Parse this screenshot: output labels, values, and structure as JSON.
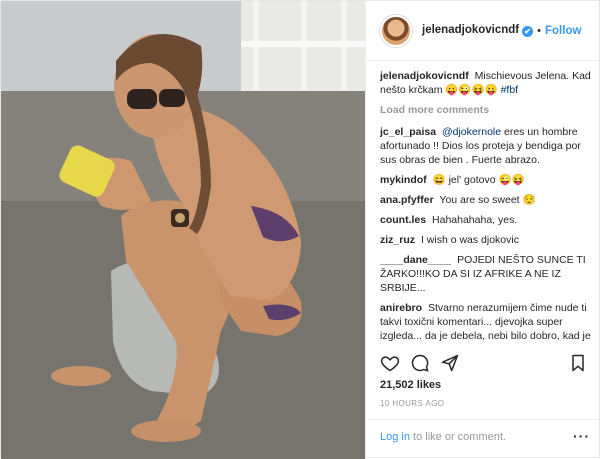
{
  "header": {
    "username": "jelenadjokovicndf",
    "dot": "•",
    "follow_label": "Follow"
  },
  "caption": {
    "username": "jelenadjokovicndf",
    "text": "Mischievous Jelena. Kad nešto krčkam 😛😜😝😛",
    "hashtag": "#fbf"
  },
  "load_more_label": "Load more comments",
  "comments": [
    {
      "username": "jc_el_paisa",
      "mention": "@djokernole",
      "text": "eres un hombre afortunado !! Dios los proteja y bendiga por sus obras de bien . Fuerte abrazo."
    },
    {
      "username": "mykindof",
      "text": "😄 jel' gotovo 😜😝"
    },
    {
      "username": "ana.pfyffer",
      "text": "You are so sweet 😌"
    },
    {
      "username": "count.les",
      "text": "Hahahahaha, yes."
    },
    {
      "username": "ziz_ruz",
      "text": "I wish o was djokovic"
    },
    {
      "username": "____dane____",
      "text": "POJEDI NEŠTO SUNCE TI ŽARKO!!!KO DA SI IZ AFRIKE A NE IZ SRBIJE..."
    },
    {
      "username": "anirebro",
      "text": "Stvarno nerazumijem čime nude ti takvi toxični komentari... djevojka super izgleda... da je debela, nebi bilo dobro, kad je mršava isto nije dobro! Svak ima različiti metabolizam i stav života... ako nemate ništa lijepo za reći, ne pišite!"
    }
  ],
  "likes": "21,502 likes",
  "timestamp": "10 HOURS AGO",
  "footer": {
    "login_link": "Log in",
    "login_rest": " to like or comment.",
    "more_label": "···"
  },
  "icons": {
    "like": "heart-icon",
    "comment": "comment-bubble-icon",
    "share": "share-arrow-icon",
    "save": "bookmark-icon",
    "verified": "verified-badge-icon"
  },
  "colors": {
    "link_blue": "#3897f0",
    "mention_blue": "#003569",
    "muted": "#999999",
    "text": "#262626"
  }
}
